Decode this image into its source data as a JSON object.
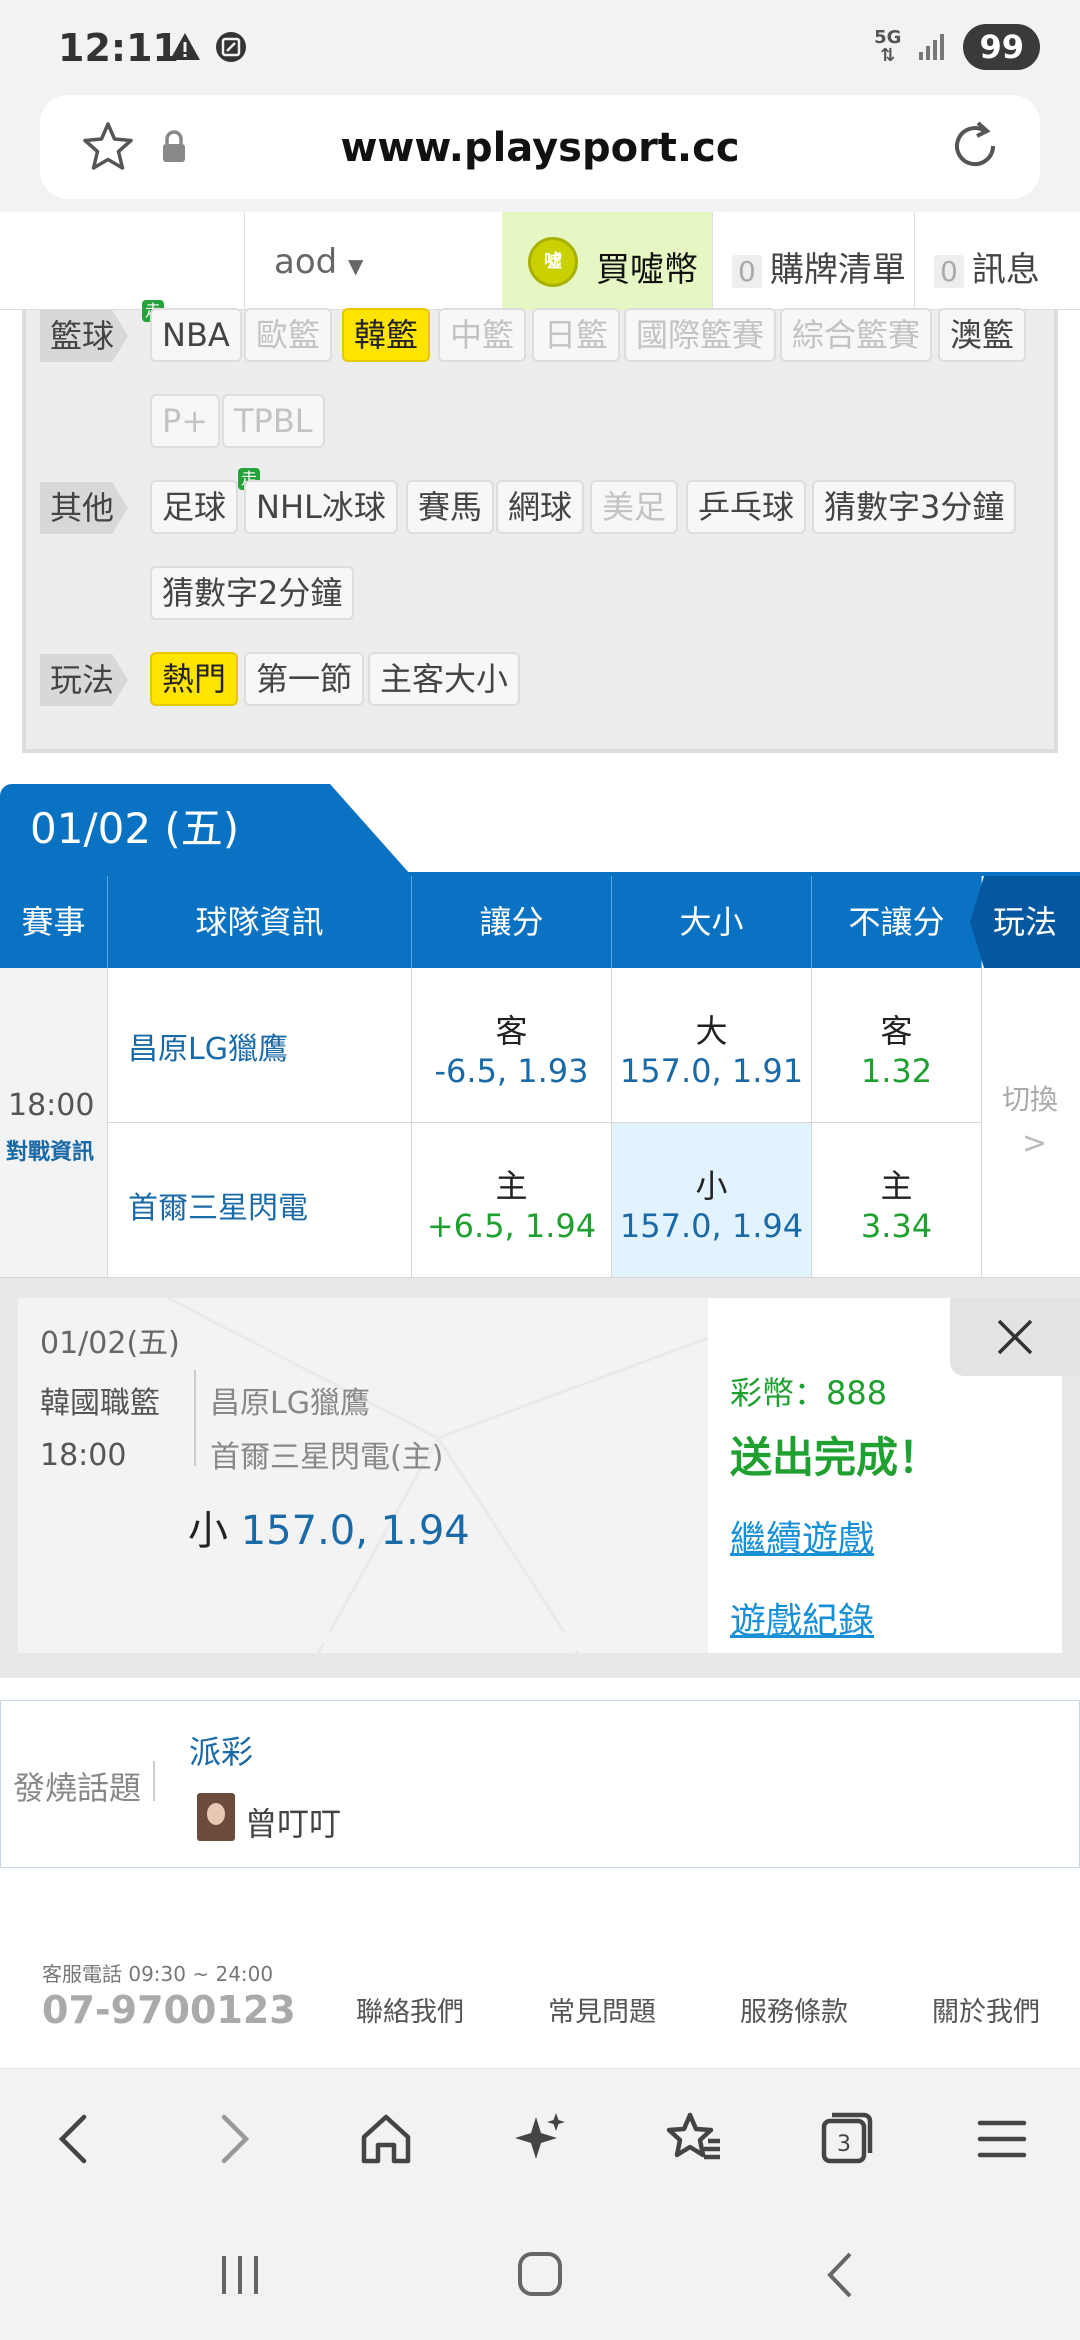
{
  "status_bar": {
    "time": "12:11",
    "network": "5G",
    "battery": "99"
  },
  "browser": {
    "url": "www.playsport.cc",
    "tab_count": "3"
  },
  "site_nav": {
    "user": "aod",
    "buy_coin": "買噓幣",
    "coin_badge": "噓",
    "cart_count": "0",
    "cart_label": "購牌清單",
    "msg_count": "0",
    "msg_label": "訊息"
  },
  "filters": {
    "basketball_label": "籃球",
    "basketball_chips": [
      "NBA",
      "歐籃",
      "韓籃",
      "中籃",
      "日籃",
      "國際籃賽",
      "綜合籃賽",
      "澳籃",
      "P+",
      "TPBL"
    ],
    "other_label": "其他",
    "other_chips": [
      "足球",
      "NHL冰球",
      "賽馬",
      "網球",
      "美足",
      "乒乓球",
      "猜數字3分鐘",
      "猜數字2分鐘"
    ],
    "walk_tag": "走",
    "play_label": "玩法",
    "play_chips": [
      "熱門",
      "第一節",
      "主客大小"
    ]
  },
  "date_tab": "01/02 (五)",
  "table": {
    "headers": [
      "賽事",
      "球隊資訊",
      "讓分",
      "大小",
      "不讓分",
      "玩法"
    ],
    "time": "18:00",
    "matchup_link": "對戰資訊",
    "away_team": "昌原LG獵鷹",
    "home_team": "首爾三星閃電",
    "away_row": {
      "spread_k": "客",
      "spread_v": "-6.5, 1.93",
      "total_k": "大",
      "total_v": "157.0, 1.91",
      "ml_k": "客",
      "ml_v": "1.32"
    },
    "home_row": {
      "spread_k": "主",
      "spread_v": "+6.5, 1.94",
      "total_k": "小",
      "total_v": "157.0, 1.94",
      "ml_k": "主",
      "ml_v": "3.34"
    },
    "switch_label": "切換",
    "switch_arrow": ">"
  },
  "ticket": {
    "date": "01/02(五)",
    "league": "韓國職籃",
    "time": "18:00",
    "team1": "昌原LG獵鷹",
    "team2": "首爾三星閃電(主)",
    "bet_side": "小",
    "bet_value": "157.0, 1.94",
    "coins": "彩幣：888",
    "done": "送出完成！",
    "continue": "繼續遊戲",
    "history": "遊戲紀錄"
  },
  "hot_topics": {
    "label": "發燒話題",
    "title": "派彩",
    "user": "曾叮叮"
  },
  "footer": {
    "phone_label": "客服電話 09:30 ~ 24:00",
    "phone": "07-9700123",
    "links": [
      "聯絡我們",
      "常見問題",
      "服務條款",
      "關於我們"
    ]
  },
  "colors": {
    "primary": "#0a72c3",
    "green": "#20a030",
    "highlight": "#ffe400",
    "selected_cell": "#e3f3fd"
  }
}
